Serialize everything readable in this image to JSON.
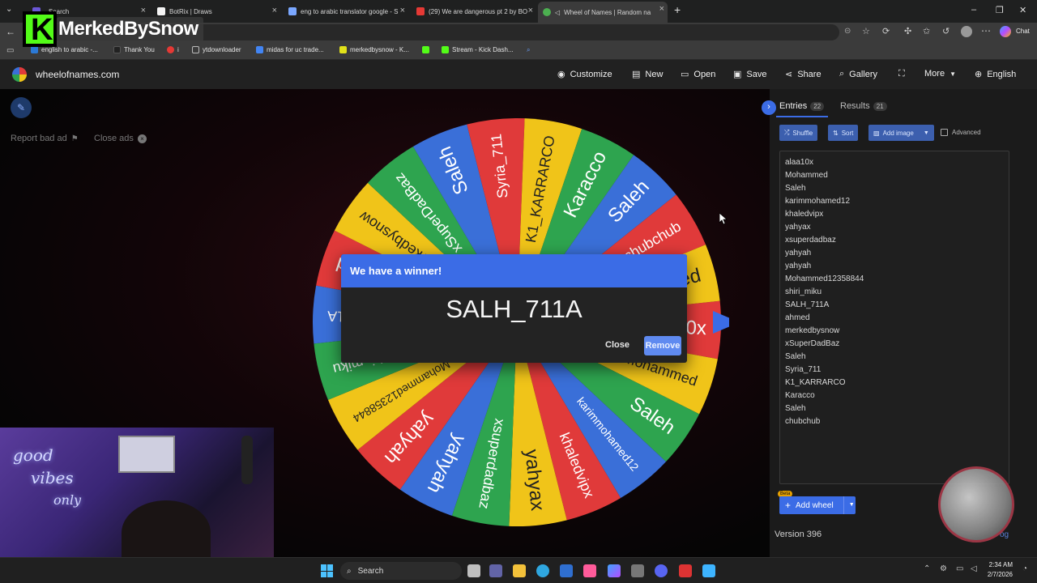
{
  "browser": {
    "tabs": [
      {
        "title": "- Search",
        "color": "#6b57d6"
      },
      {
        "title": "BotRix | Draws",
        "color": "#f4f4f4"
      },
      {
        "title": "eng to arabic translator google - S",
        "color": "#7aa7ff"
      },
      {
        "title": "(29) We are dangerous pt 2 by BO",
        "color": "#e53935"
      },
      {
        "title": "Wheel of Names | Random na",
        "color": "#4caf50",
        "active": true
      }
    ],
    "new_tab": "+",
    "chat_label": "Chat",
    "bookmarks": [
      {
        "label": "english to arabic -...",
        "color": "#2b79d6"
      },
      {
        "label": "Thank You",
        "color": "#222"
      },
      {
        "label": "i",
        "color": "#e53935"
      },
      {
        "label": "ytdownloader",
        "color": "#888"
      },
      {
        "label": "midas for uc trade...",
        "color": "#4285f4"
      },
      {
        "label": "merkedbysnow - K...",
        "color": "#53fc18"
      },
      {
        "label": "",
        "color": "#53fc18"
      },
      {
        "label": "Stream - Kick Dash...",
        "color": "#53fc18"
      }
    ]
  },
  "overlay": {
    "logo_letter": "K",
    "streamer_name": "MerkedBySnow"
  },
  "app": {
    "site_name": "wheelofnames.com",
    "nav": [
      {
        "label": "Customize",
        "icon": "palette-icon"
      },
      {
        "label": "New",
        "icon": "new-file-icon"
      },
      {
        "label": "Open",
        "icon": "folder-icon"
      },
      {
        "label": "Save",
        "icon": "save-icon"
      },
      {
        "label": "Share",
        "icon": "share-icon"
      },
      {
        "label": "Gallery",
        "icon": "search-icon"
      },
      {
        "label": "",
        "icon": "fullscreen-icon"
      },
      {
        "label": "More",
        "icon": "chevron-down-icon"
      },
      {
        "label": "English",
        "icon": "globe-icon"
      }
    ],
    "report_bad_ad": "Report bad ad",
    "close_ads": "Close ads",
    "wheel_labels": [
      "alaa10x",
      "Mohammed",
      "Saleh",
      "karimmohamed12",
      "khaledvipx",
      "yahyax",
      "xsuperdadbaz",
      "yahyah",
      "yahyah",
      "Mohammed12358844",
      "shiri_miku",
      "SALH_711A",
      "ahmed",
      "merkedbysnow",
      "xSuperDadBaz",
      "Saleh",
      "Syria_711",
      "K1_KARRARCO",
      "Karacco",
      "Saleh",
      "chubchub",
      "ahmed"
    ],
    "wheel_colors": [
      "#e03a3a",
      "#f0c419",
      "#2ea44f",
      "#3a6fd8"
    ],
    "panel": {
      "entries_tab": "Entries",
      "entries_count": "22",
      "results_tab": "Results",
      "results_count": "21",
      "shuffle": "Shuffle",
      "sort": "Sort",
      "add_image": "Add image",
      "advanced": "Advanced",
      "entries": [
        "alaa10x",
        "Mohammed",
        "Saleh",
        "karimmohamed12",
        "khaledvipx",
        "yahyax",
        "xsuperdadbaz",
        "yahyah",
        "yahyah",
        "Mohammed12358844",
        "shiri_miku",
        "SALH_711A",
        "ahmed",
        "merkedbysnow",
        "xSuperDadBaz",
        "Saleh",
        "Syria_711",
        "K1_KARRARCO",
        "Karacco",
        "Saleh",
        "chubchub"
      ],
      "beta": "Beta",
      "add_wheel": "Add wheel",
      "version": "Version 396",
      "log": "og"
    },
    "dialog": {
      "title": "We have a winner!",
      "winner": "SALH_711A",
      "close": "Close",
      "remove": "Remove"
    }
  },
  "taskbar": {
    "search": "Search",
    "time": "2:34 AM",
    "date": "2/7/2026"
  },
  "webcam": {
    "neon_text_1": "good",
    "neon_text_2": "vibes",
    "neon_text_3": "only"
  }
}
